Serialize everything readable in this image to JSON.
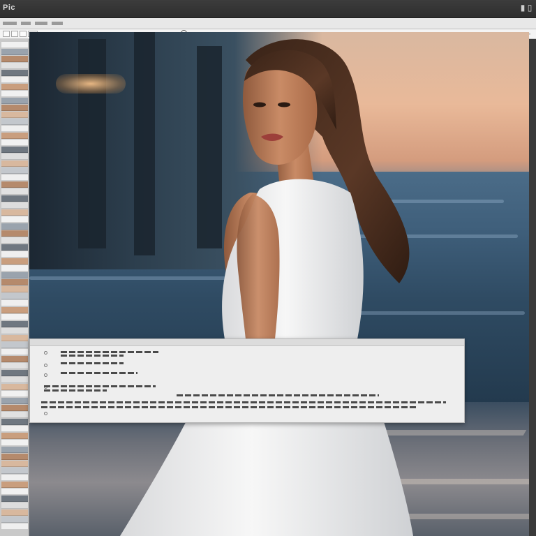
{
  "window": {
    "title": "Pic",
    "controls": [
      "minimize-icon",
      "close-icon"
    ]
  },
  "toolbar": {
    "zoom_progress": 0.29
  },
  "dialog": {
    "visible": true
  },
  "colors": {
    "titlebar": "#333333",
    "menubar": "#e8e8e8",
    "accent": "#6f8fb8",
    "dress": "#f2f2f2",
    "hair": "#4a2e1f",
    "skin": "#c98b66"
  }
}
